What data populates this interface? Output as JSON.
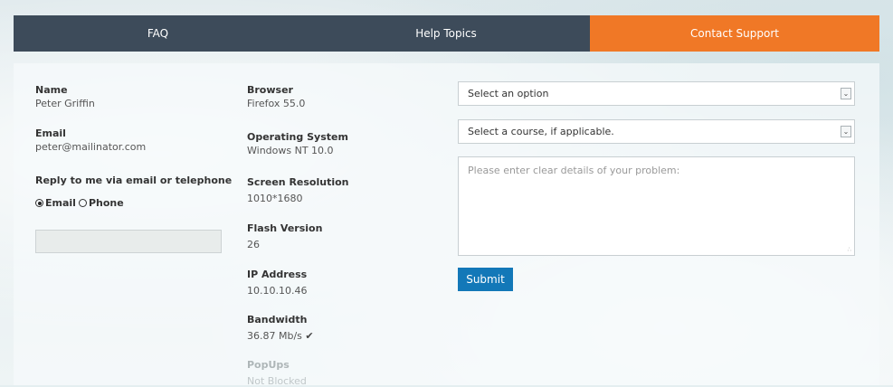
{
  "tabs": {
    "faq": "FAQ",
    "help": "Help Topics",
    "contact": "Contact Support",
    "active_color": "#f07826",
    "inactive_color": "#3d4b5a"
  },
  "user": {
    "name_label": "Name",
    "name": "Peter Griffin",
    "email_label": "Email",
    "email": "peter@mailinator.com",
    "reply_label": "Reply to me via email or telephone",
    "reply_options": [
      "Email",
      "Phone"
    ],
    "reply_selected": "Email"
  },
  "system": {
    "browser_label": "Browser",
    "browser": "Firefox 55.0",
    "os_label": "Operating System",
    "os": "Windows NT 10.0",
    "resolution_label": "Screen Resolution",
    "resolution": "1010*1680",
    "flash_label": "Flash Version",
    "flash": "26",
    "ip_label": "IP Address",
    "ip": "10.10.10.46",
    "bandwidth_label": "Bandwidth",
    "bandwidth": "36.87 Mb/s",
    "bandwidth_icon": "checkmark-icon",
    "popups_label": "PopUps",
    "popups": "Not Blocked"
  },
  "form": {
    "option_select": "Select an option",
    "course_select": "Select a course, if applicable.",
    "details_placeholder": "Please enter clear details of your problem:",
    "submit_label": "Submit",
    "submit_color": "#1378b8"
  }
}
